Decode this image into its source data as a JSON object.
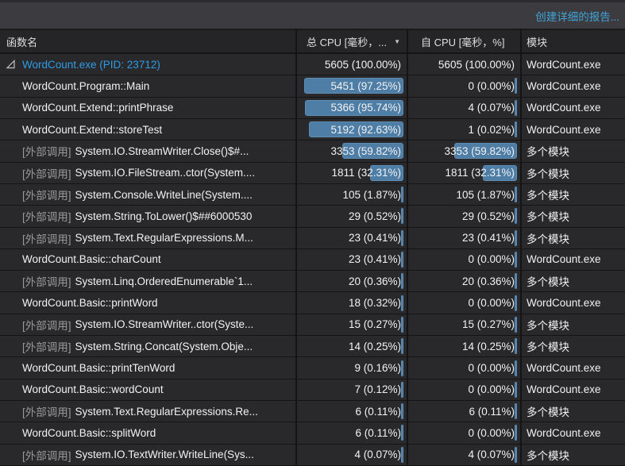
{
  "toolbar": {
    "report_link": "创建详细的报告..."
  },
  "columns": [
    {
      "label": "函数名"
    },
    {
      "label": "总 CPU [毫秒，...",
      "sort_indicator": "▼"
    },
    {
      "label": "自 CPU [毫秒，%]"
    },
    {
      "label": "模块"
    }
  ],
  "external_prefix": "[外部调用]",
  "colors": {
    "link_blue": "#41a3d6",
    "process_blue": "#2f9ce5",
    "bar_fill": "#4e7da6",
    "external_gray": "#9a9a9a"
  },
  "rows": [
    {
      "function": "WordCount.exe (PID: 23712)",
      "external": false,
      "root": true,
      "total": "5605 (100.00%)",
      "total_pct": null,
      "self": "5605 (100.00%)",
      "self_pct": null,
      "module": "WordCount.exe"
    },
    {
      "function": "WordCount.Program::Main",
      "external": false,
      "total": "5451 (97.25%)",
      "total_pct": 97.25,
      "self": "0 (0.00%)",
      "self_pct": 0,
      "module": "WordCount.exe"
    },
    {
      "function": "WordCount.Extend::printPhrase",
      "external": false,
      "total": "5366 (95.74%)",
      "total_pct": 95.74,
      "self": "4 (0.07%)",
      "self_pct": 0.07,
      "module": "WordCount.exe"
    },
    {
      "function": "WordCount.Extend::storeTest",
      "external": false,
      "total": "5192 (92.63%)",
      "total_pct": 92.63,
      "self": "1 (0.02%)",
      "self_pct": 0.02,
      "module": "WordCount.exe"
    },
    {
      "function": "System.IO.StreamWriter.Close()$#...",
      "external": true,
      "total": "3353 (59.82%)",
      "total_pct": 59.82,
      "self": "3353 (59.82%)",
      "self_pct": 59.82,
      "module": "多个模块"
    },
    {
      "function": "System.IO.FileStream..ctor(System....",
      "external": true,
      "total": "1811 (32.31%)",
      "total_pct": 32.31,
      "self": "1811 (32.31%)",
      "self_pct": 32.31,
      "module": "多个模块"
    },
    {
      "function": "System.Console.WriteLine(System....",
      "external": true,
      "total": "105 (1.87%)",
      "total_pct": 1.87,
      "self": "105 (1.87%)",
      "self_pct": 1.87,
      "module": "多个模块"
    },
    {
      "function": "System.String.ToLower()$##6000530",
      "external": true,
      "total": "29 (0.52%)",
      "total_pct": 0.52,
      "self": "29 (0.52%)",
      "self_pct": 0.52,
      "module": "多个模块"
    },
    {
      "function": "System.Text.RegularExpressions.M...",
      "external": true,
      "total": "23 (0.41%)",
      "total_pct": 0.41,
      "self": "23 (0.41%)",
      "self_pct": 0.41,
      "module": "多个模块"
    },
    {
      "function": "WordCount.Basic::charCount",
      "external": false,
      "total": "23 (0.41%)",
      "total_pct": 0.41,
      "self": "0 (0.00%)",
      "self_pct": 0,
      "module": "WordCount.exe"
    },
    {
      "function": "System.Linq.OrderedEnumerable`1...",
      "external": true,
      "total": "20 (0.36%)",
      "total_pct": 0.36,
      "self": "20 (0.36%)",
      "self_pct": 0.36,
      "module": "多个模块"
    },
    {
      "function": "WordCount.Basic::printWord",
      "external": false,
      "total": "18 (0.32%)",
      "total_pct": 0.32,
      "self": "0 (0.00%)",
      "self_pct": 0,
      "module": "WordCount.exe"
    },
    {
      "function": "System.IO.StreamWriter..ctor(Syste...",
      "external": true,
      "total": "15 (0.27%)",
      "total_pct": 0.27,
      "self": "15 (0.27%)",
      "self_pct": 0.27,
      "module": "多个模块"
    },
    {
      "function": "System.String.Concat(System.Obje...",
      "external": true,
      "total": "14 (0.25%)",
      "total_pct": 0.25,
      "self": "14 (0.25%)",
      "self_pct": 0.25,
      "module": "多个模块"
    },
    {
      "function": "WordCount.Basic::printTenWord",
      "external": false,
      "total": "9 (0.16%)",
      "total_pct": 0.16,
      "self": "0 (0.00%)",
      "self_pct": 0,
      "module": "WordCount.exe"
    },
    {
      "function": "WordCount.Basic::wordCount",
      "external": false,
      "total": "7 (0.12%)",
      "total_pct": 0.12,
      "self": "0 (0.00%)",
      "self_pct": 0,
      "module": "WordCount.exe"
    },
    {
      "function": "System.Text.RegularExpressions.Re...",
      "external": true,
      "total": "6 (0.11%)",
      "total_pct": 0.11,
      "self": "6 (0.11%)",
      "self_pct": 0.11,
      "module": "多个模块"
    },
    {
      "function": "WordCount.Basic::splitWord",
      "external": false,
      "total": "6 (0.11%)",
      "total_pct": 0.11,
      "self": "0 (0.00%)",
      "self_pct": 0,
      "module": "WordCount.exe"
    },
    {
      "function": "System.IO.TextWriter.WriteLine(Sys...",
      "external": true,
      "total": "4 (0.07%)",
      "total_pct": 0.07,
      "self": "4 (0.07%)",
      "self_pct": 0.07,
      "module": "多个模块"
    }
  ]
}
